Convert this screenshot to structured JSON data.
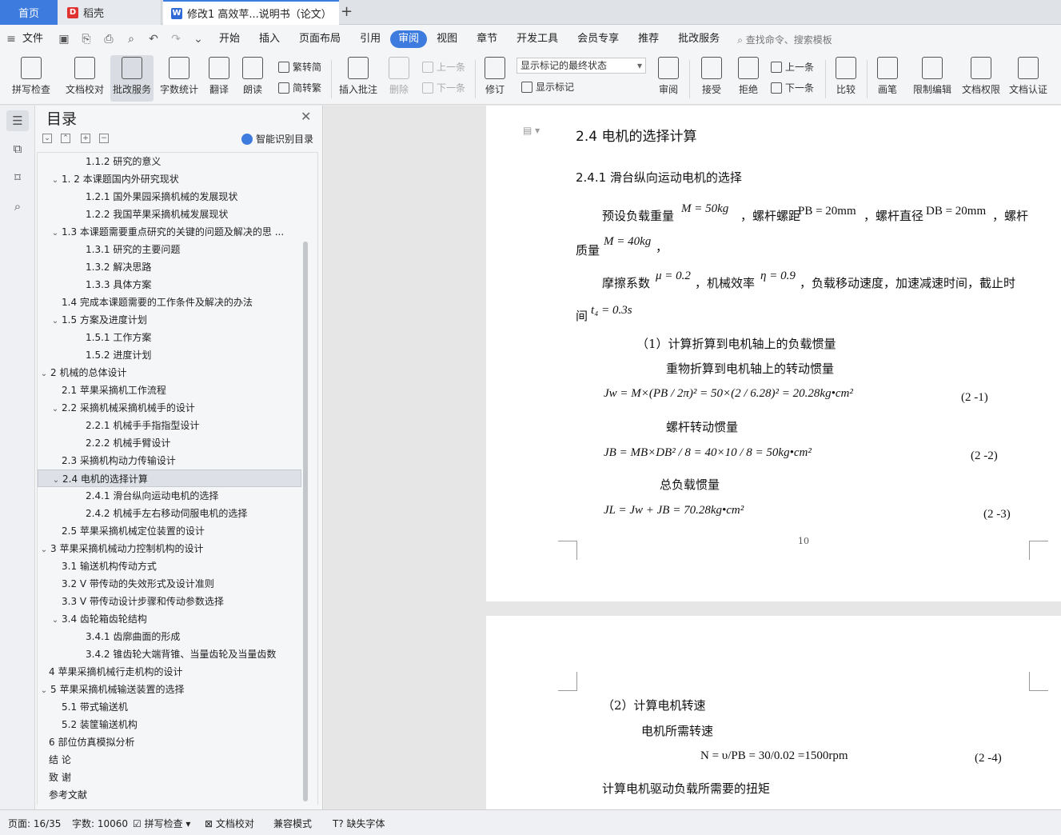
{
  "tabs": {
    "home": "首页",
    "daoke": "稻壳",
    "doc": "修改1 高效苹...说明书（论文）",
    "add": "+"
  },
  "menu": {
    "file": "文件",
    "items": [
      "开始",
      "插入",
      "页面布局",
      "引用",
      "审阅",
      "视图",
      "章节",
      "开发工具",
      "会员专享",
      "推荐",
      "批改服务"
    ],
    "active": "审阅",
    "search": "查找命令、搜索模板"
  },
  "ribbon": {
    "spellcheck": "拼写检查",
    "proofread": "文档校对",
    "correction": "批改服务",
    "wordcount": "字数统计",
    "translate": "翻译",
    "read": "朗读",
    "trad": "繁转简",
    "simp": "简转繁",
    "insert_comment": "插入批注",
    "delete": "删除",
    "prev": "上一条",
    "next": "下一条",
    "revise": "修订",
    "markup_state": "显示标记的最终状态",
    "show_markup": "显示标记",
    "review": "审阅",
    "accept": "接受",
    "reject": "拒绝",
    "prev2": "上一条",
    "next2": "下一条",
    "compare": "比较",
    "pen": "画笔",
    "restrict": "限制编辑",
    "rights": "文档权限",
    "certify": "文档认证"
  },
  "toc": {
    "title": "目录",
    "ai_label": "智能识别目录",
    "items": [
      {
        "text": "1.1.2 研究的意义",
        "level": 3,
        "arrow": ""
      },
      {
        "text": "1. 2 本课题国内外研究现状",
        "level": 2,
        "arrow": "v"
      },
      {
        "text": "1.2.1 国外果园采摘机械的发展现状",
        "level": 3,
        "arrow": ""
      },
      {
        "text": "1.2.2 我国苹果采摘机械发展现状",
        "level": 3,
        "arrow": ""
      },
      {
        "text": "1.3 本课题需要重点研究的关键的问题及解决的思 ...",
        "level": 2,
        "arrow": "v"
      },
      {
        "text": "1.3.1  研究的主要问题",
        "level": 3,
        "arrow": ""
      },
      {
        "text": "1.3.2  解决思路",
        "level": 3,
        "arrow": ""
      },
      {
        "text": "1.3.3 具体方案",
        "level": 3,
        "arrow": ""
      },
      {
        "text": "1.4 完成本课题需要的工作条件及解决的办法",
        "level": 2,
        "arrow": ""
      },
      {
        "text": "1.5  方案及进度计划",
        "level": 2,
        "arrow": "v"
      },
      {
        "text": "1.5.1  工作方案",
        "level": 3,
        "arrow": ""
      },
      {
        "text": "1.5.2 进度计划",
        "level": 3,
        "arrow": ""
      },
      {
        "text": "2 机械的总体设计",
        "level": 1,
        "arrow": "v"
      },
      {
        "text": "2.1 苹果采摘机工作流程",
        "level": 2,
        "arrow": ""
      },
      {
        "text": "2.2 采摘机械采摘机械手的设计",
        "level": 2,
        "arrow": "v"
      },
      {
        "text": "2.2.1 机械手手指指型设计",
        "level": 3,
        "arrow": ""
      },
      {
        "text": "2.2.2 机械手臂设计",
        "level": 3,
        "arrow": ""
      },
      {
        "text": "2.3 采摘机构动力传输设计",
        "level": 2,
        "arrow": ""
      },
      {
        "text": "2.4 电机的选择计算",
        "level": 2,
        "arrow": "v",
        "selected": true
      },
      {
        "text": "2.4.1 滑台纵向运动电机的选择",
        "level": 3,
        "arrow": ""
      },
      {
        "text": "2.4.2 机械手左右移动伺服电机的选择",
        "level": 3,
        "arrow": ""
      },
      {
        "text": "2.5 苹果采摘机械定位装置的设计",
        "level": 2,
        "arrow": ""
      },
      {
        "text": "3 苹果采摘机械动力控制机构的设计",
        "level": 1,
        "arrow": "v"
      },
      {
        "text": "3.1 输送机构传动方式",
        "level": 2,
        "arrow": ""
      },
      {
        "text": "3.2 V 带传动的失效形式及设计准则",
        "level": 2,
        "arrow": ""
      },
      {
        "text": "3.3 V 带传动设计步骤和传动参数选择",
        "level": 2,
        "arrow": ""
      },
      {
        "text": "3.4 齿轮箱齿轮结构",
        "level": 2,
        "arrow": "v"
      },
      {
        "text": "3.4.1 齿廓曲面的形成",
        "level": 3,
        "arrow": ""
      },
      {
        "text": "3.4.2 锥齿轮大端背锥、当量齿轮及当量齿数",
        "level": 3,
        "arrow": ""
      },
      {
        "text": "4 苹果采摘机械行走机构的设计",
        "level": 1,
        "arrow": ""
      },
      {
        "text": "5 苹果采摘机械输送装置的选择",
        "level": 1,
        "arrow": "v"
      },
      {
        "text": "5.1 带式输送机",
        "level": 2,
        "arrow": ""
      },
      {
        "text": "5.2  装筐输送机构",
        "level": 2,
        "arrow": ""
      },
      {
        "text": "6 部位仿真模拟分析",
        "level": 1,
        "arrow": ""
      },
      {
        "text": "结    论",
        "level": 1,
        "arrow": ""
      },
      {
        "text": "致    谢",
        "level": 1,
        "arrow": ""
      },
      {
        "text": "参考文献",
        "level": 1,
        "arrow": ""
      }
    ]
  },
  "doc": {
    "h2": "2.4 电机的选择计算",
    "h3": "2.4.1 滑台纵向运动电机的选择",
    "p1a": "预设负载重量",
    "p1_m": "M = 50kg",
    "p1b": "，螺杆螺距",
    "p1_pb": "PB = 20mm",
    "p1c": "，螺杆直径",
    "p1_db": "DB = 20mm",
    "p1d": "，螺杆",
    "p2a": "质量",
    "p2_m": "M = 40kg",
    "p2b": "，",
    "p3a": "摩擦系数",
    "p3_mu": "μ = 0.2",
    "p3b": "，机械效率",
    "p3_eta": "η = 0.9",
    "p3c": "，负载移动速度，加速减速时间，截止时",
    "p4a": "间",
    "p4_t": "t₄ = 0.3s",
    "s1": "（1）计算折算到电机轴上的负载惯量",
    "s1a": "重物折算到电机轴上的转动惯量",
    "eq1": "Jw = M×(PB / 2π)² = 50×(2 / 6.28)² = 20.28kg•cm²",
    "eq1no": "(2 -1)",
    "s1b": "螺杆转动惯量",
    "eq2": "JB = MB×DB² / 8 = 40×10 / 8 = 50kg•cm²",
    "eq2no": "(2 -2)",
    "s1c": "总负载惯量",
    "eq3": "JL = Jw + JB = 70.28kg•cm²",
    "eq3no": "(2 -3)",
    "pagenum": "10",
    "s2": "（2）计算电机转速",
    "s2a": "电机所需转速",
    "eq4": "N = υ/PB = 30/0.02 =1500rpm",
    "eq4no": "(2 -4)",
    "s3": "计算电机驱动负载所需要的扭矩"
  },
  "status": {
    "page": "页面: 16/35",
    "words": "字数: 10060",
    "spell": "拼写检查",
    "proof": "文档校对",
    "compat": "兼容模式",
    "missing_font": "缺失字体"
  }
}
